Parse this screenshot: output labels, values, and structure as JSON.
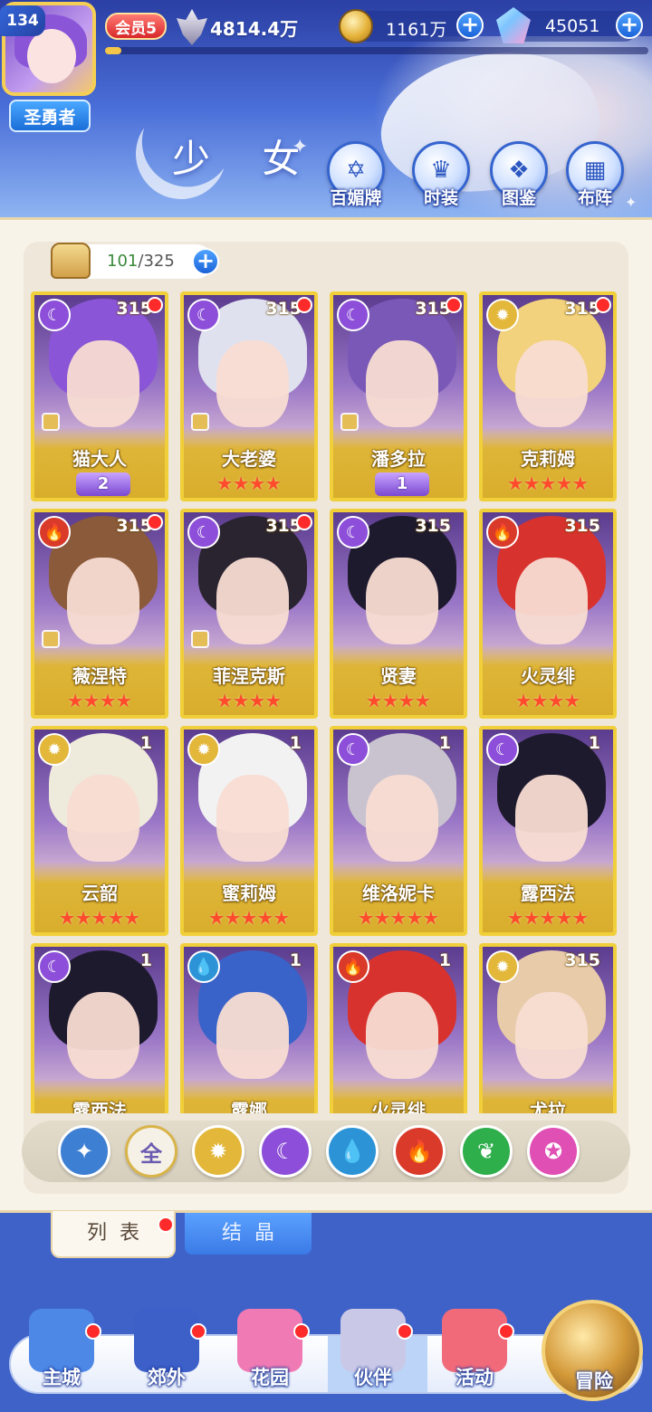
{
  "header": {
    "level": "134",
    "title_badge": "圣勇者",
    "vip": "会员5",
    "power": "4814.4万",
    "gold": "1161万",
    "gems": "45051",
    "xp_progress": 0.03
  },
  "page": {
    "title": "少 女",
    "functions": [
      {
        "label": "百媚牌",
        "icon": "card-deck-icon"
      },
      {
        "label": "时装",
        "icon": "costume-icon"
      },
      {
        "label": "图鉴",
        "icon": "book-icon"
      },
      {
        "label": "布阵",
        "icon": "formation-grid-icon"
      }
    ]
  },
  "inventory": {
    "current": "101",
    "separator": "/",
    "max": "325"
  },
  "cards": [
    {
      "name": "猫大人",
      "level": "315",
      "element": "moon",
      "rank": "2",
      "stars": 0,
      "dot": true,
      "hair": "#8a55d6",
      "pawn": true
    },
    {
      "name": "大老婆",
      "level": "315",
      "element": "moon",
      "rank": "",
      "stars": 4,
      "dot": true,
      "hair": "#dfe1ef",
      "pawn": true
    },
    {
      "name": "潘多拉",
      "level": "315",
      "element": "moon",
      "rank": "1",
      "stars": 0,
      "dot": true,
      "hair": "#7a58b8",
      "pawn": true
    },
    {
      "name": "克莉姆",
      "level": "315",
      "element": "sun",
      "rank": "",
      "stars": 5,
      "dot": true,
      "hair": "#f2d27c",
      "pawn": false
    },
    {
      "name": "薇涅特",
      "level": "315",
      "element": "fire",
      "rank": "",
      "stars": 4,
      "dot": true,
      "hair": "#8a5a3a",
      "pawn": true
    },
    {
      "name": "菲涅克斯",
      "level": "315",
      "element": "moon",
      "rank": "",
      "stars": 4,
      "dot": true,
      "hair": "#2a2430",
      "pawn": true
    },
    {
      "name": "贤妻",
      "level": "315",
      "element": "moon",
      "rank": "",
      "stars": 4,
      "dot": false,
      "hair": "#1e1a2e",
      "pawn": false
    },
    {
      "name": "火灵绯",
      "level": "315",
      "element": "fire",
      "rank": "",
      "stars": 4,
      "dot": false,
      "hair": "#d8322e",
      "pawn": false
    },
    {
      "name": "云韶",
      "level": "1",
      "element": "sun",
      "rank": "",
      "stars": 5,
      "dot": false,
      "hair": "#eeeadc",
      "pawn": false
    },
    {
      "name": "蜜莉姆",
      "level": "1",
      "element": "sun",
      "rank": "",
      "stars": 5,
      "dot": false,
      "hair": "#f2f2f2",
      "pawn": false
    },
    {
      "name": "维洛妮卡",
      "level": "1",
      "element": "moon",
      "rank": "",
      "stars": 5,
      "dot": false,
      "hair": "#c9c3cf",
      "pawn": false
    },
    {
      "name": "露西法",
      "level": "1",
      "element": "moon",
      "rank": "",
      "stars": 5,
      "dot": false,
      "hair": "#1e1a2e",
      "pawn": false
    },
    {
      "name": "露西法",
      "level": "1",
      "element": "moon",
      "rank": "",
      "stars": 0,
      "dot": false,
      "hair": "#1e1a2e",
      "pawn": false
    },
    {
      "name": "露娜",
      "level": "1",
      "element": "water",
      "rank": "",
      "stars": 0,
      "dot": false,
      "hair": "#3a63c9",
      "pawn": false
    },
    {
      "name": "火灵绯",
      "level": "1",
      "element": "fire",
      "rank": "",
      "stars": 0,
      "dot": false,
      "hair": "#d8322e",
      "pawn": false
    },
    {
      "name": "尤拉",
      "level": "315",
      "element": "sun",
      "rank": "",
      "stars": 0,
      "dot": false,
      "hair": "#e8cba8",
      "pawn": false
    }
  ],
  "filters": [
    {
      "id": "wind",
      "label": "",
      "glyph": "✦",
      "color": "#3d7fd2"
    },
    {
      "id": "all",
      "label": "全",
      "glyph": "",
      "color": "#f5f1e6"
    },
    {
      "id": "sun",
      "label": "",
      "glyph": "✹",
      "color": "#e3b73a"
    },
    {
      "id": "moon",
      "label": "",
      "glyph": "☾",
      "color": "#8d4fd9"
    },
    {
      "id": "water",
      "label": "",
      "glyph": "💧",
      "color": "#2c94d6"
    },
    {
      "id": "fire",
      "label": "",
      "glyph": "🔥",
      "color": "#d93a2a"
    },
    {
      "id": "nature",
      "label": "",
      "glyph": "❦",
      "color": "#2fae4c"
    },
    {
      "id": "star",
      "label": "",
      "glyph": "✪",
      "color": "#e04fb4"
    }
  ],
  "tabs": {
    "list": "列表",
    "crystal": "结晶"
  },
  "nav": [
    {
      "label": "主城",
      "icon": "castle-icon",
      "color": "#4d88e6",
      "dot": true
    },
    {
      "label": "郊外",
      "icon": "portal-icon",
      "color": "#3c5fc8",
      "dot": true
    },
    {
      "label": "花园",
      "icon": "heart-icon",
      "color": "#f07ab4",
      "dot": true
    },
    {
      "label": "伙伴",
      "icon": "partner-icon",
      "color": "#c9c8e6",
      "dot": true
    },
    {
      "label": "活动",
      "icon": "gift-icon",
      "color": "#f06a7a",
      "dot": true
    },
    {
      "label": "冒险",
      "icon": "compass-icon",
      "color": "#d49a3a",
      "dot": false
    }
  ]
}
